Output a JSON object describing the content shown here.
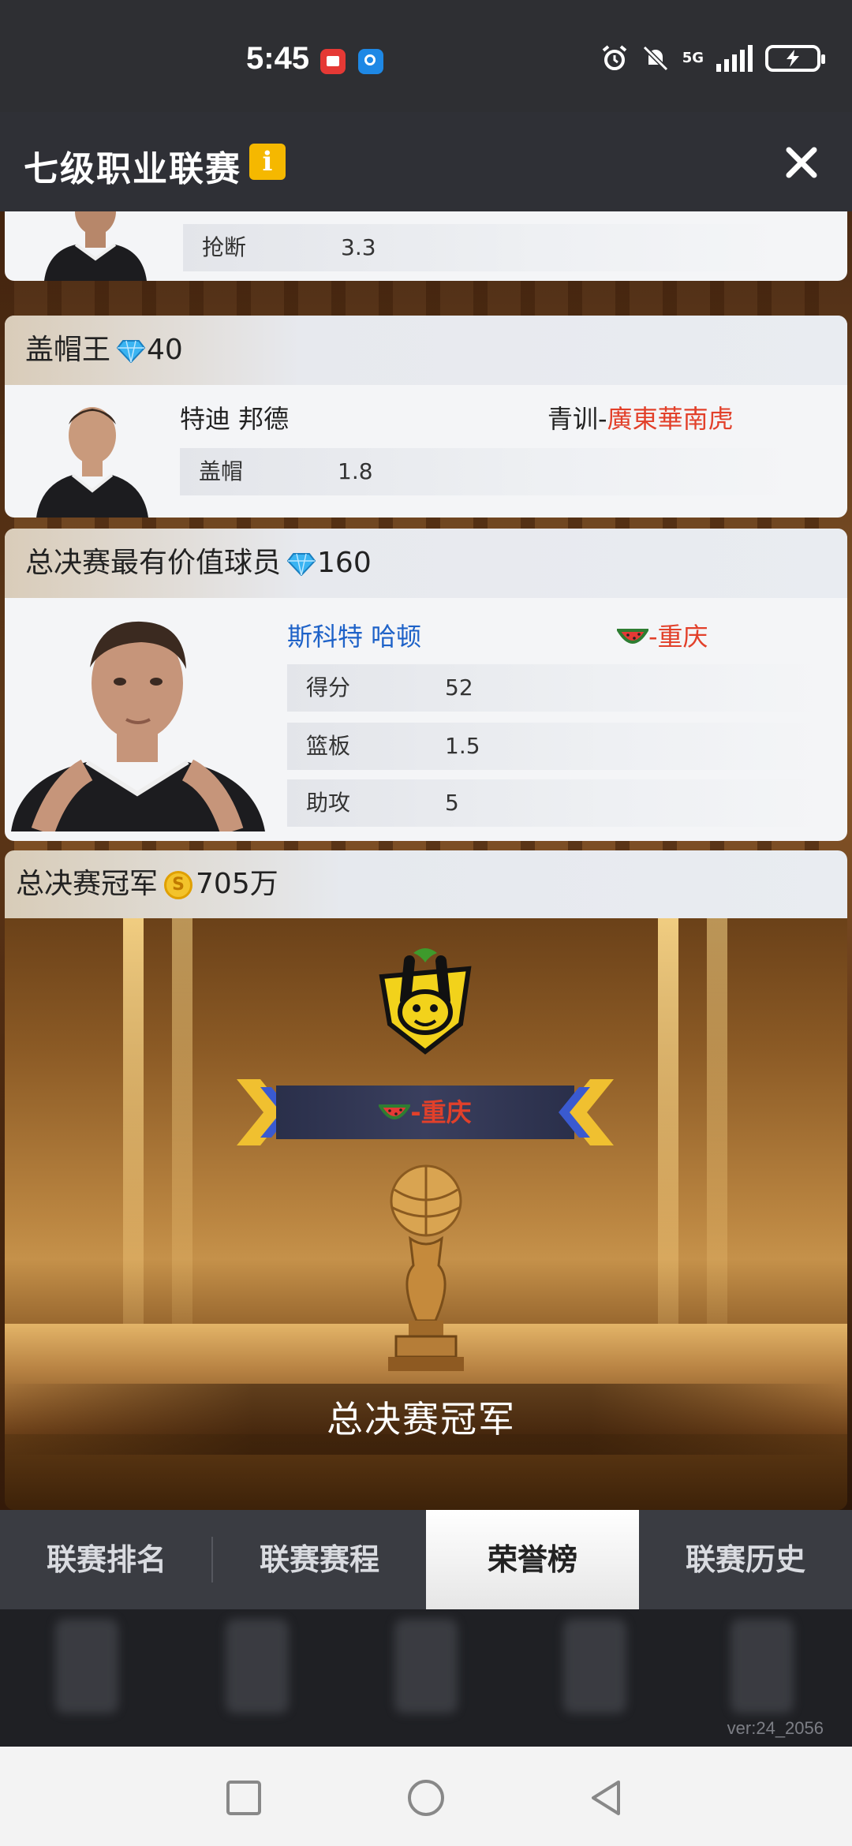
{
  "status_bar": {
    "time": "5:45",
    "network": "5G",
    "icons": [
      "alarm-icon",
      "mute-icon",
      "signal-icon",
      "battery-charging-icon"
    ]
  },
  "header": {
    "title": "七级职业联赛",
    "info_label": "i"
  },
  "steal_card": {
    "stat_label": "抢断",
    "stat_value": "3.3"
  },
  "block_king": {
    "title": "盖帽王",
    "reward": "40",
    "player_name": "特迪 邦德",
    "team_prefix": "青训-",
    "team_name": "廣東華南虎",
    "stat_label": "盖帽",
    "stat_value": "1.8"
  },
  "finals_mvp": {
    "title": "总决赛最有价值球员",
    "reward": "160",
    "player_name": "斯科特 哈顿",
    "team_name": "-重庆",
    "stats": [
      {
        "label": "得分",
        "value": "52"
      },
      {
        "label": "篮板",
        "value": "1.5"
      },
      {
        "label": "助攻",
        "value": "5"
      }
    ]
  },
  "champion": {
    "title": "总决赛冠军",
    "reward": "705万",
    "team_name": "-重庆",
    "label": "总决赛冠军"
  },
  "tabs": [
    {
      "label": "联赛排名",
      "active": false
    },
    {
      "label": "联赛赛程",
      "active": false
    },
    {
      "label": "荣誉榜",
      "active": true
    },
    {
      "label": "联赛历史",
      "active": false
    }
  ],
  "version": "ver:24_2056",
  "colors": {
    "team_red": "#e2402a",
    "player_blue": "#1e62c8",
    "badge_gold": "#f5b800"
  }
}
